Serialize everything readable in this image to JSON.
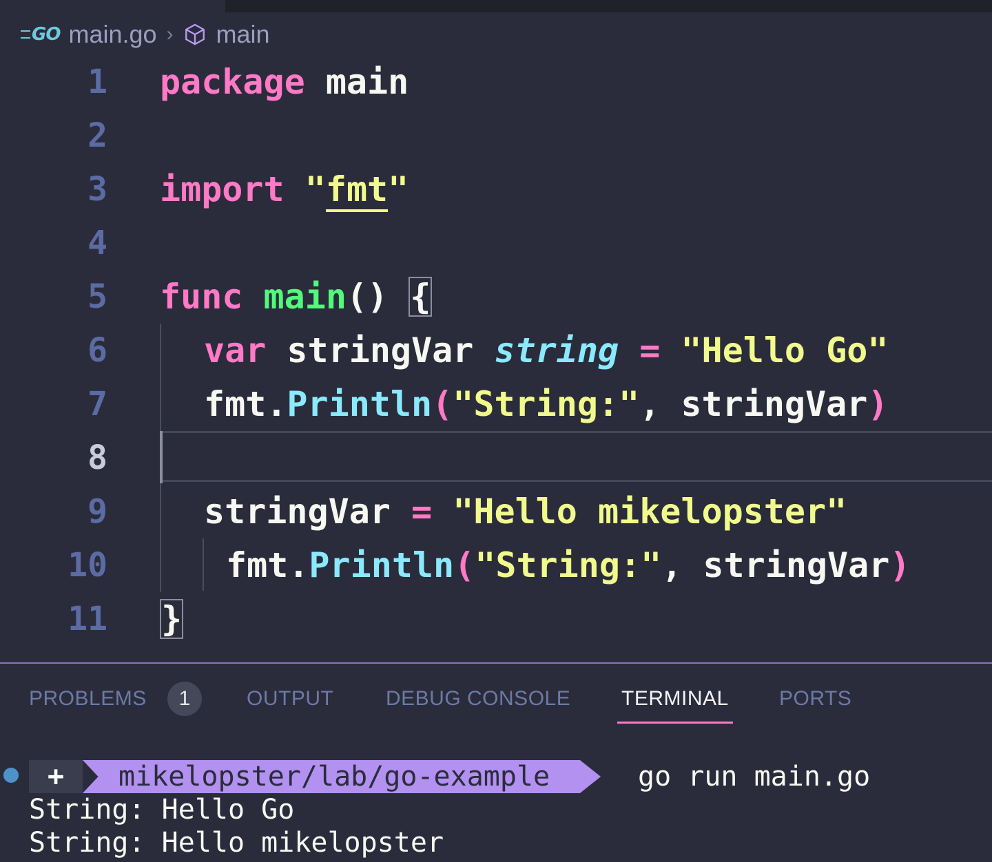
{
  "breadcrumb": {
    "file_label": "main.go",
    "file_icon_text": "GO",
    "symbol_label": "main"
  },
  "editor": {
    "line_numbers": [
      "1",
      "2",
      "3",
      "4",
      "5",
      "6",
      "7",
      "8",
      "9",
      "10",
      "11"
    ],
    "active_line": "8",
    "lines": {
      "l1": {
        "kw": "package",
        "name": "main"
      },
      "l3": {
        "kw": "import",
        "q1": "\"",
        "pkg": "fmt",
        "q2": "\""
      },
      "l5": {
        "kw": "func",
        "fn": "main",
        "parens": "()",
        "brace": "{"
      },
      "l6": {
        "kw": "var",
        "ident": "stringVar",
        "type": "string",
        "op": "=",
        "str": "\"Hello Go\""
      },
      "l7": {
        "pkg": "fmt",
        "dot": ".",
        "call": "Println",
        "lp": "(",
        "str": "\"String:\"",
        "comma": ", ",
        "arg": "stringVar",
        "rp": ")"
      },
      "l9": {
        "ident": "stringVar",
        "op": "=",
        "str": "\"Hello mikelopster\""
      },
      "l10": {
        "pkg": "fmt",
        "dot": ".",
        "call": "Println",
        "lp": "(",
        "str": "\"String:\"",
        "comma": ", ",
        "arg": "stringVar",
        "rp": ")"
      },
      "l11": {
        "brace": "}"
      }
    }
  },
  "panel": {
    "tabs": [
      {
        "label": "PROBLEMS"
      },
      {
        "label": "OUTPUT"
      },
      {
        "label": "DEBUG CONSOLE"
      },
      {
        "label": "TERMINAL"
      },
      {
        "label": "PORTS"
      }
    ],
    "problems_count": "1",
    "active_tab": "TERMINAL"
  },
  "terminal": {
    "prompt_plus": "+",
    "prompt_path": "mikelopster/lab/go-example",
    "command": "go run main.go",
    "output": [
      "String: Hello Go",
      "String: Hello mikelopster"
    ]
  },
  "colors": {
    "background": "#2b2c3b",
    "keyword": "#ff79c6",
    "function": "#50fa7b",
    "string": "#f1fa8c",
    "type": "#8be9fd",
    "prompt_path_bg": "#b291f0",
    "active_tab_underline": "#ff79c6"
  }
}
